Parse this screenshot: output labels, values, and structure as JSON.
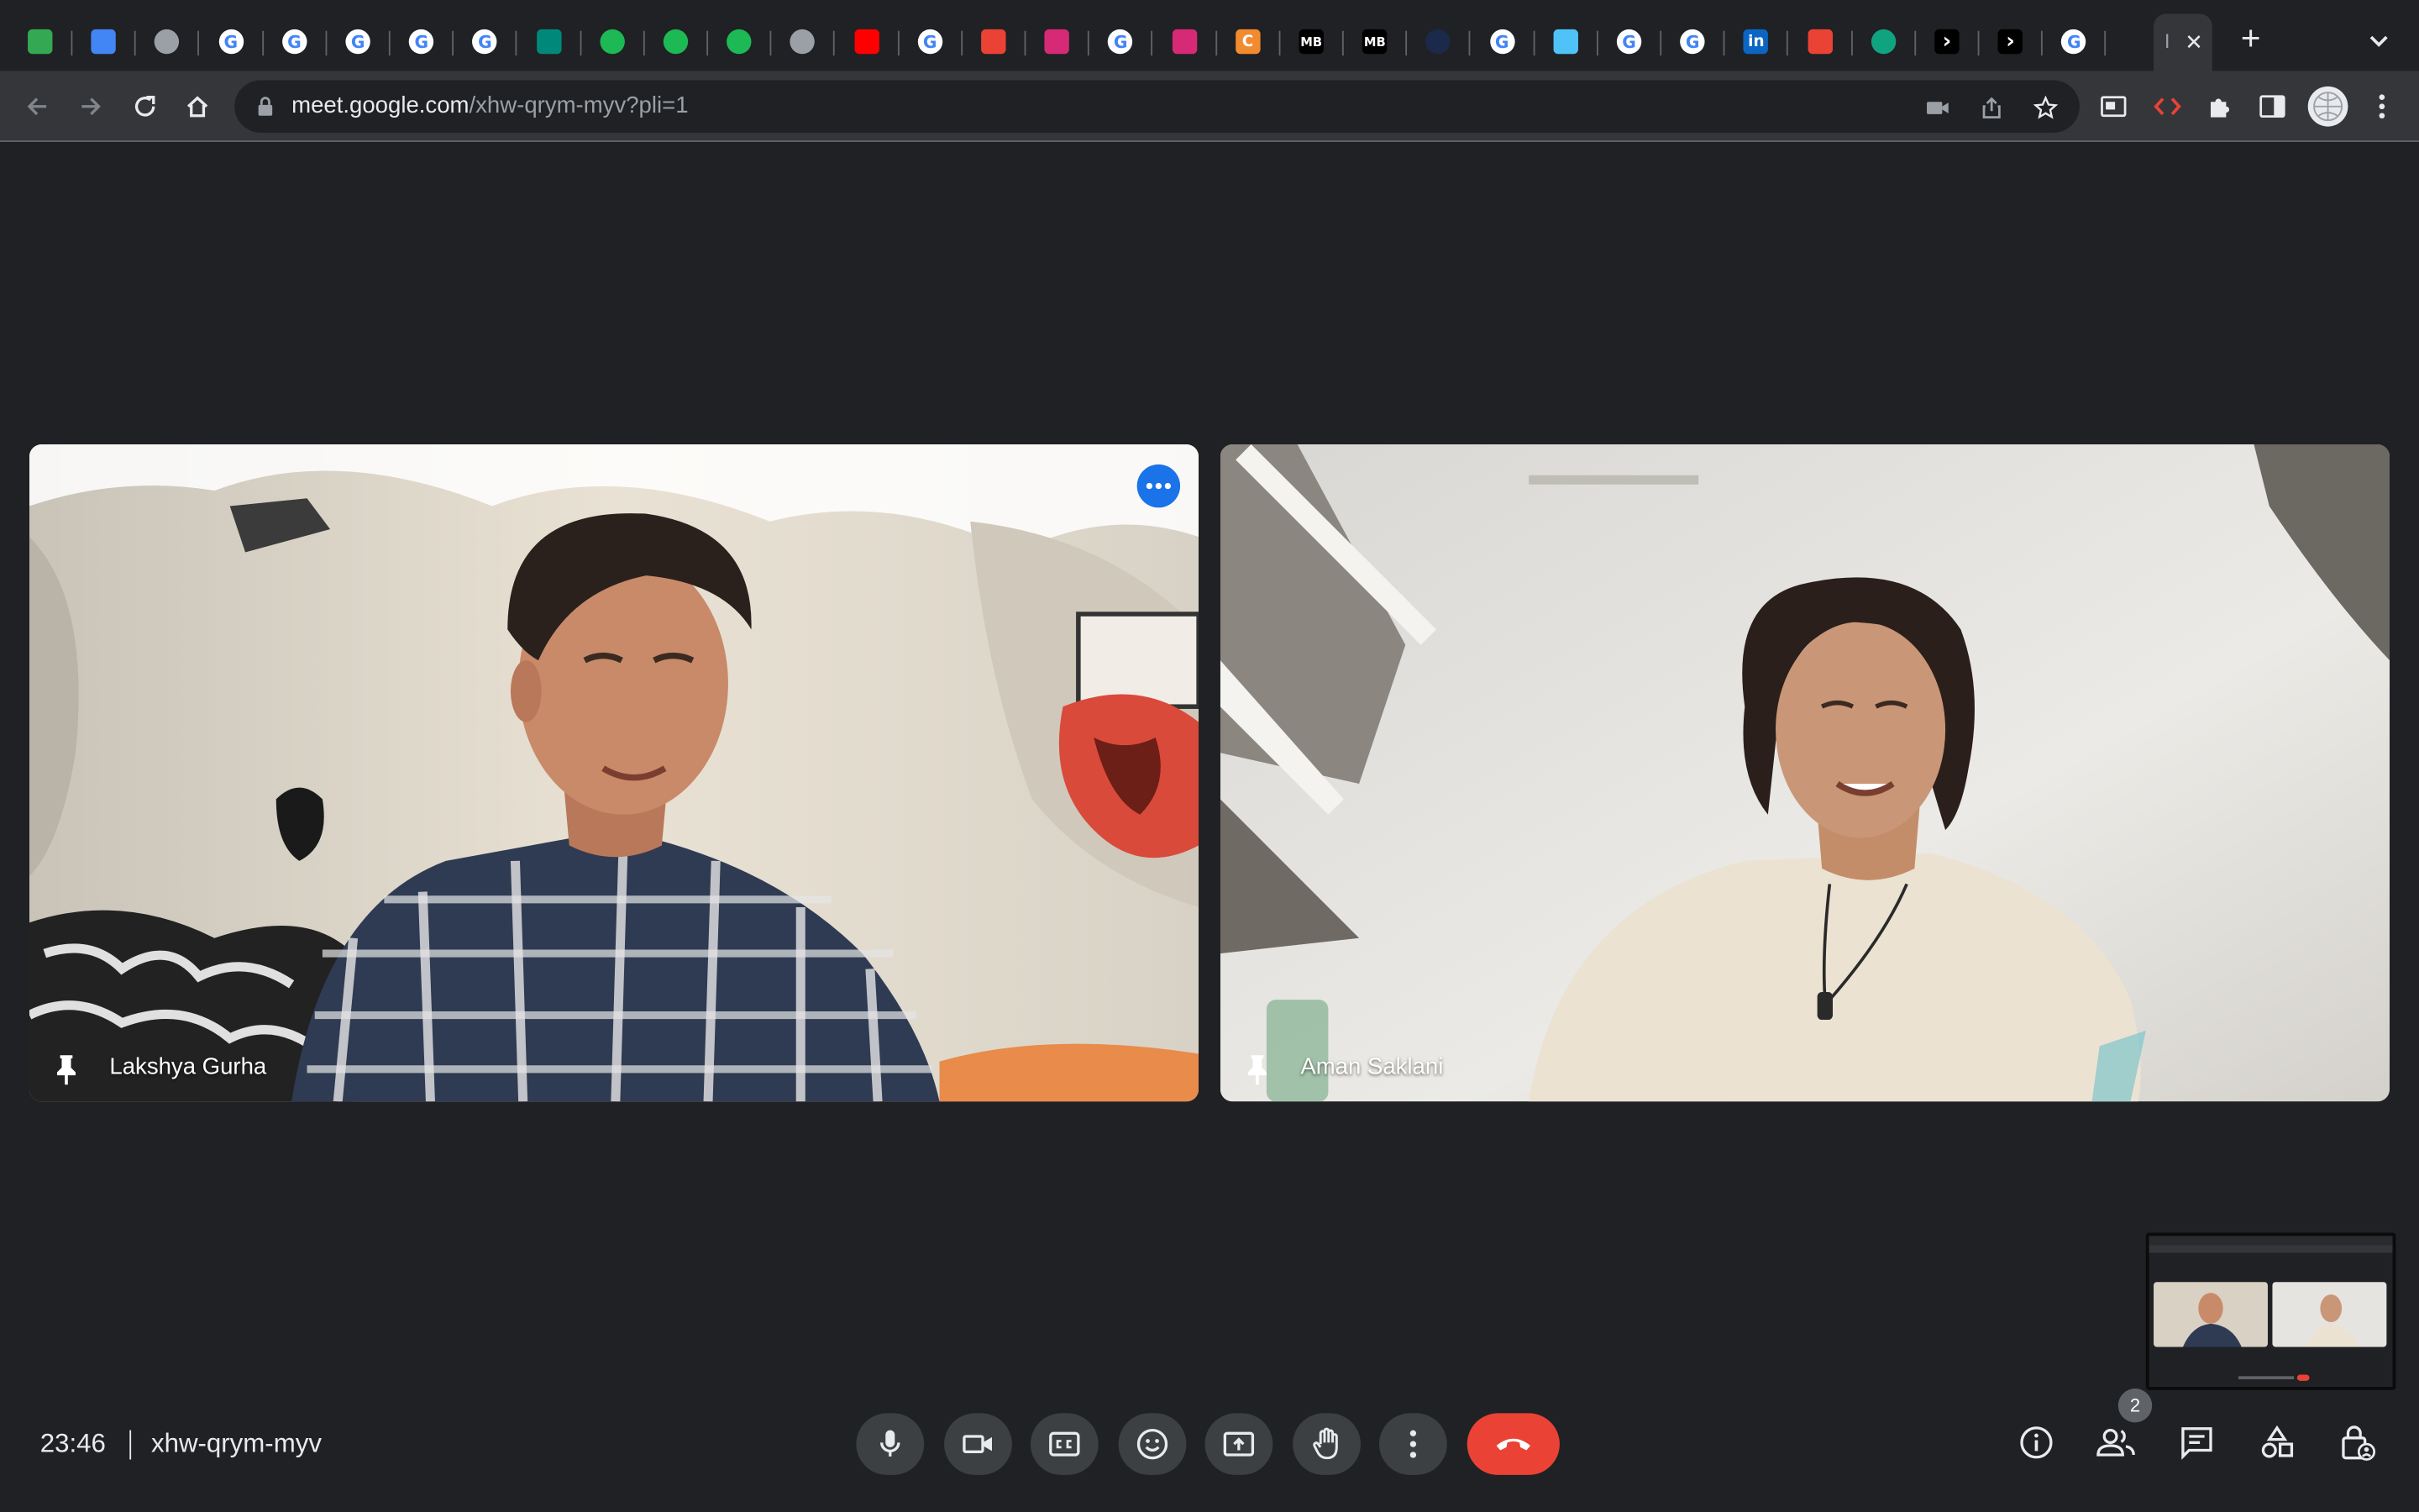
{
  "browser": {
    "tabs": [
      {
        "icon": "google-drive-icon",
        "color": "#34a853"
      },
      {
        "icon": "google-docs-icon",
        "color": "#4285f4"
      },
      {
        "icon": "globe-icon",
        "color": "#9aa0a6"
      },
      {
        "icon": "google-icon",
        "color": "#ffffff"
      },
      {
        "icon": "google-icon",
        "color": "#ffffff"
      },
      {
        "icon": "google-icon",
        "color": "#ffffff"
      },
      {
        "icon": "google-icon",
        "color": "#ffffff"
      },
      {
        "icon": "chrome-icon",
        "color": "#ffffff"
      },
      {
        "icon": "google-meet-icon",
        "color": "#00897b"
      },
      {
        "icon": "spotify-icon",
        "color": "#1db954"
      },
      {
        "icon": "spotify-icon",
        "color": "#1db954"
      },
      {
        "icon": "spotify-icon",
        "color": "#1db954"
      },
      {
        "icon": "globe-icon",
        "color": "#9aa0a6"
      },
      {
        "icon": "youtube-icon",
        "color": "#ff0000"
      },
      {
        "icon": "google-icon",
        "color": "#ffffff"
      },
      {
        "icon": "gmail-icon",
        "color": "#ea4335"
      },
      {
        "icon": "instagram-icon",
        "color": "#d62976"
      },
      {
        "icon": "chrome-icon",
        "color": "#ffffff"
      },
      {
        "icon": "instagram-icon",
        "color": "#d62976"
      },
      {
        "icon": "c-app-icon",
        "color": "#f28b30"
      },
      {
        "icon": "mb-icon",
        "color": "#000000"
      },
      {
        "icon": "mb-icon",
        "color": "#000000"
      },
      {
        "icon": "dark-circle-icon",
        "color": "#1b2a4a"
      },
      {
        "icon": "amazon-icon",
        "color": "#ffffff"
      },
      {
        "icon": "chart-icon",
        "color": "#4fc3f7"
      },
      {
        "icon": "chrome-icon",
        "color": "#ffffff"
      },
      {
        "icon": "google-icon",
        "color": "#ffffff"
      },
      {
        "icon": "linkedin-icon",
        "color": "#0a66c2"
      },
      {
        "icon": "gmail-icon",
        "color": "#ea4335"
      },
      {
        "icon": "chatgpt-icon",
        "color": "#10a37f"
      },
      {
        "icon": "arrow-app-icon",
        "color": "#000000"
      },
      {
        "icon": "arrow-app-icon",
        "color": "#000000"
      },
      {
        "icon": "google-icon",
        "color": "#ffffff"
      }
    ],
    "active_tab": {
      "icon": "google-meet-icon",
      "label": "I"
    },
    "new_tab_label": "+",
    "url_host": "meet.google.com",
    "url_path": "/xhw-qrym-myv?pli=1"
  },
  "meet": {
    "participants": [
      {
        "name": "Lakshya Gurha"
      },
      {
        "name": "Aman Saklani"
      }
    ],
    "time": "23:46",
    "code": "xhw-qrym-myv",
    "people_count": "2",
    "colors": {
      "accent": "#1a73e8",
      "end_call": "#ea4335",
      "button_bg": "#3c4043",
      "background": "#202124"
    }
  }
}
